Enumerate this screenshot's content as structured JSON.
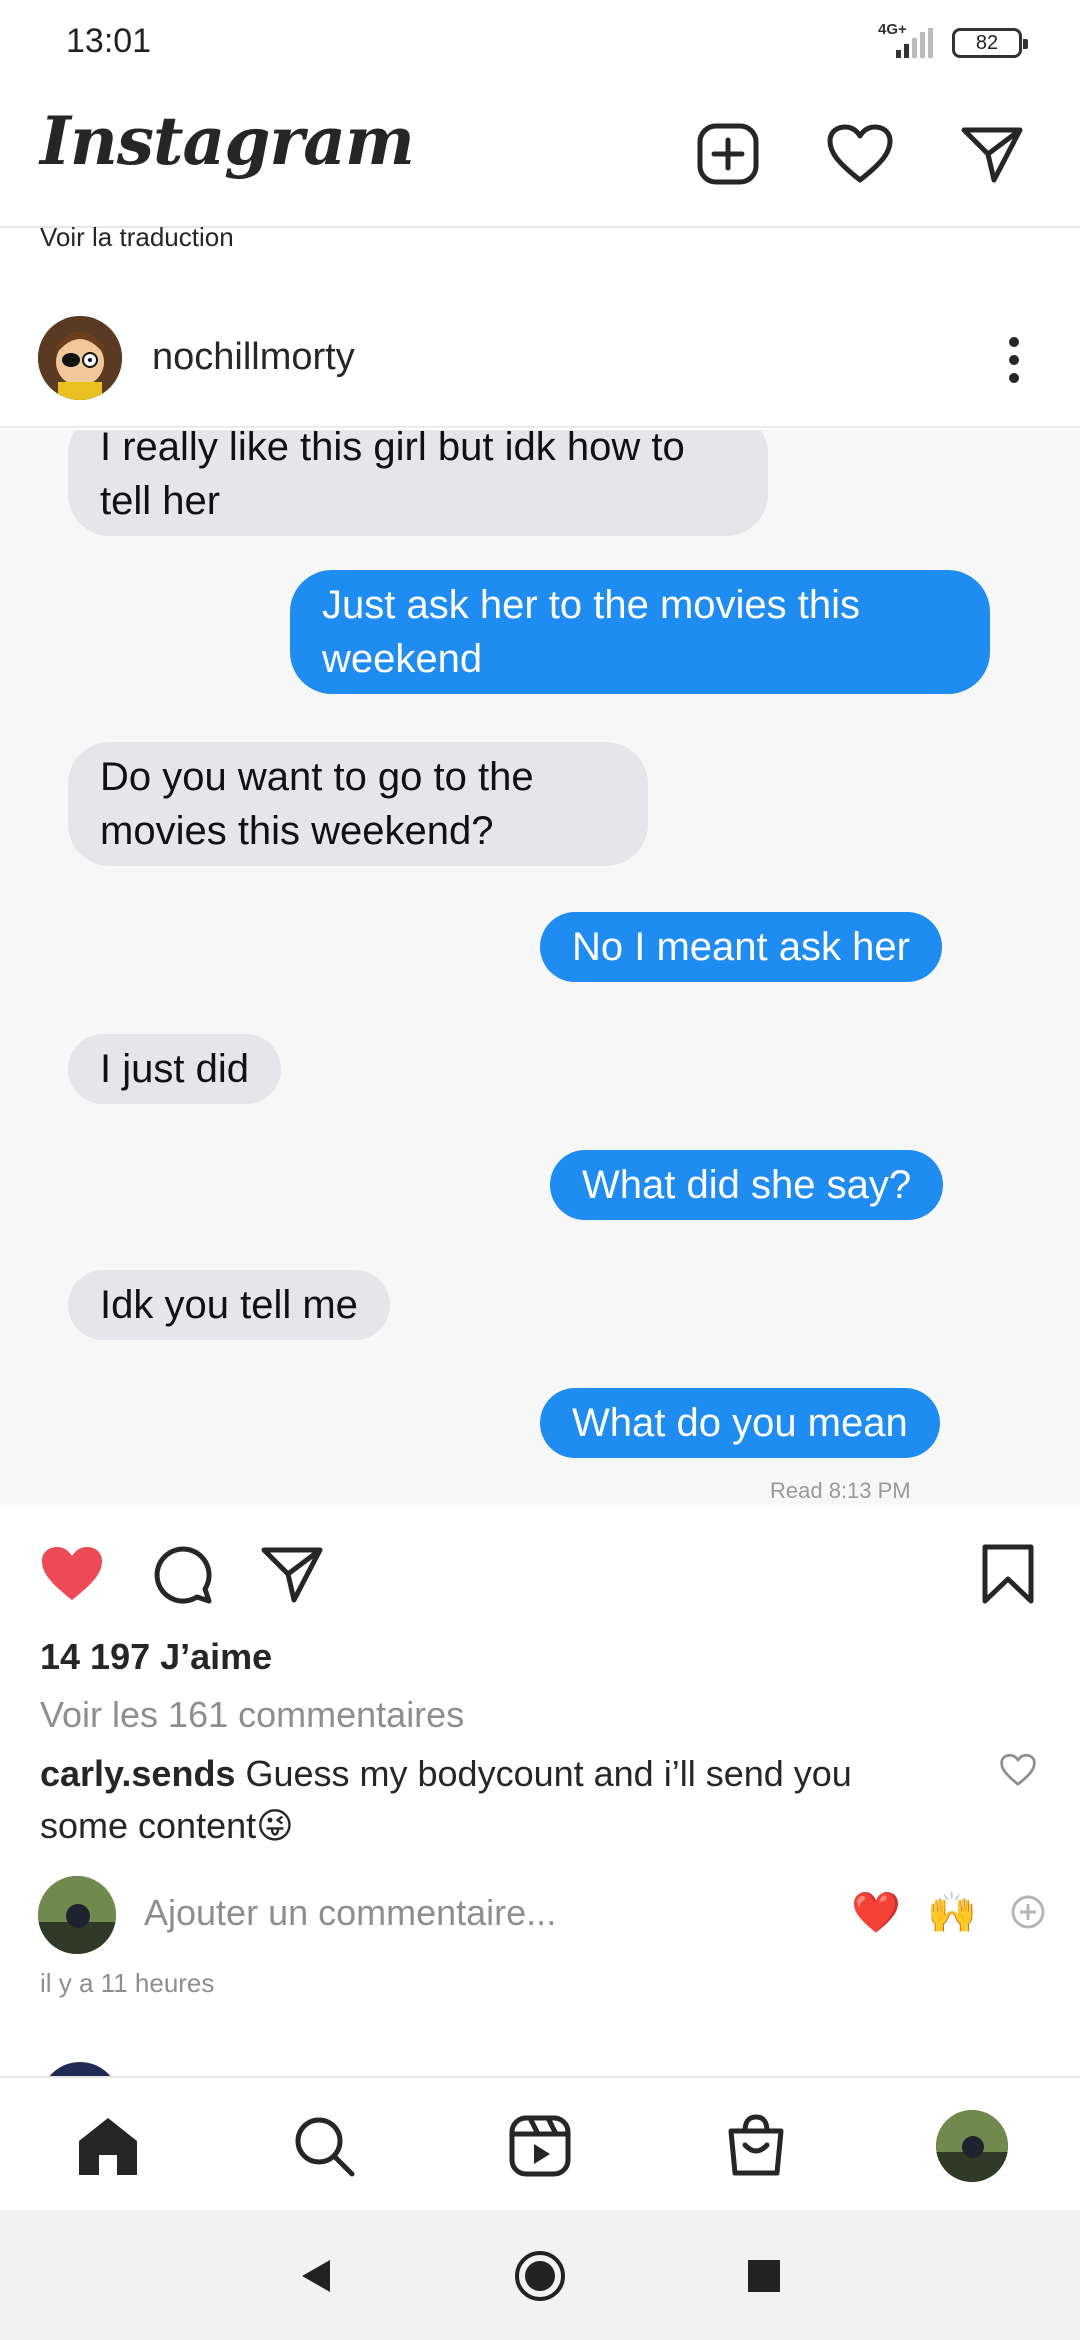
{
  "status_bar": {
    "time": "13:01",
    "network": "4G+",
    "battery": "82"
  },
  "header": {
    "logo": "Instagram",
    "icons": [
      "add-post-icon",
      "heart-icon",
      "direct-message-icon"
    ]
  },
  "translate_link": "Voir la traduction",
  "post": {
    "username": "nochillmorty",
    "image_messages": [
      {
        "side": "in",
        "text": "I really like this girl but idk how to tell her"
      },
      {
        "side": "out",
        "text": "Just ask her to the movies this weekend"
      },
      {
        "side": "in",
        "text": "Do you want to go to the movies this weekend?"
      },
      {
        "side": "out",
        "text": "No I meant ask her"
      },
      {
        "side": "in",
        "text": "I just did"
      },
      {
        "side": "out",
        "text": "What did she say?"
      },
      {
        "side": "in",
        "text": "Idk you tell me"
      },
      {
        "side": "out",
        "text": "What do you mean"
      }
    ],
    "read_receipt": "Read 8:13 PM",
    "liked": true,
    "likes": "14 197 J’aime",
    "view_comments": "Voir les 161 commentaires",
    "top_comment": {
      "user": "carly.sends",
      "text": "Guess my bodycount and i’ll send you some content",
      "emoji": "😜"
    },
    "add_comment_placeholder": "Ajouter un commentaire...",
    "quick_emojis": [
      "❤️",
      "🙌"
    ],
    "time_ago": "il y a 11 heures"
  },
  "bottom_nav": [
    "home-icon",
    "search-icon",
    "reels-icon",
    "shop-icon",
    "profile-avatar"
  ],
  "colors": {
    "like_red": "#ed4956",
    "bubble_blue": "#1e8cf0",
    "bubble_gray": "#e5e5ea"
  }
}
